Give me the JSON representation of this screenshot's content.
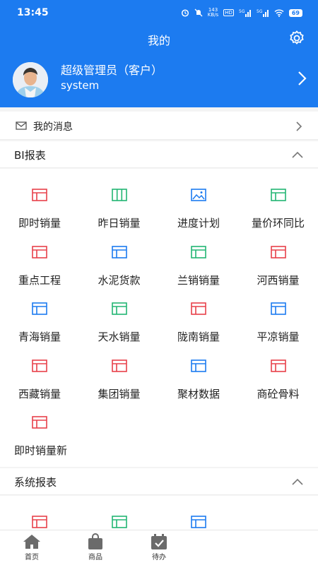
{
  "status": {
    "time": "13:45",
    "net_speed_value": "143",
    "net_speed_unit": "KB/s",
    "signal_label": "5G",
    "battery": "69"
  },
  "header": {
    "title": "我的"
  },
  "profile": {
    "name": "超级管理员（客户）",
    "account": "system"
  },
  "messages": {
    "label": "我的消息"
  },
  "bi_section": {
    "title": "BI报表",
    "items": [
      {
        "label": "即时销量",
        "icon": "table-icon",
        "color": "#e8404a"
      },
      {
        "label": "昨日销量",
        "icon": "columns-icon",
        "color": "#22b573"
      },
      {
        "label": "进度计划",
        "icon": "image-icon",
        "color": "#1c7bf0"
      },
      {
        "label": "量价环同比",
        "icon": "table-icon",
        "color": "#22b573"
      },
      {
        "label": "重点工程",
        "icon": "table-icon",
        "color": "#e8404a"
      },
      {
        "label": "水泥货款",
        "icon": "table-icon",
        "color": "#1c7bf0"
      },
      {
        "label": "兰销销量",
        "icon": "table-icon",
        "color": "#22b573"
      },
      {
        "label": "河西销量",
        "icon": "table-icon",
        "color": "#e8404a"
      },
      {
        "label": "青海销量",
        "icon": "table-icon",
        "color": "#1c7bf0"
      },
      {
        "label": "天水销量",
        "icon": "table-icon",
        "color": "#22b573"
      },
      {
        "label": "陇南销量",
        "icon": "table-icon",
        "color": "#e8404a"
      },
      {
        "label": "平凉销量",
        "icon": "table-icon",
        "color": "#1c7bf0"
      },
      {
        "label": "西藏销量",
        "icon": "table-icon",
        "color": "#e8404a"
      },
      {
        "label": "集团销量",
        "icon": "table-icon",
        "color": "#e8404a"
      },
      {
        "label": "聚材数据",
        "icon": "table-icon",
        "color": "#1c7bf0"
      },
      {
        "label": "商砼骨料",
        "icon": "table-icon",
        "color": "#e8404a"
      },
      {
        "label": "即时销量新",
        "icon": "table-icon",
        "color": "#e8404a"
      }
    ]
  },
  "system_section": {
    "title": "系统报表",
    "items": [
      {
        "icon": "table-icon",
        "color": "#e8404a"
      },
      {
        "icon": "table-icon",
        "color": "#22b573"
      },
      {
        "icon": "table-icon",
        "color": "#1c7bf0"
      }
    ]
  },
  "bottom_nav": [
    {
      "label": "首页",
      "icon": "home-icon"
    },
    {
      "label": "商品",
      "icon": "bag-icon"
    },
    {
      "label": "待办",
      "icon": "calendar-check-icon"
    }
  ],
  "colors": {
    "primary": "#1c7bf0",
    "red": "#e8404a",
    "green": "#22b573"
  }
}
